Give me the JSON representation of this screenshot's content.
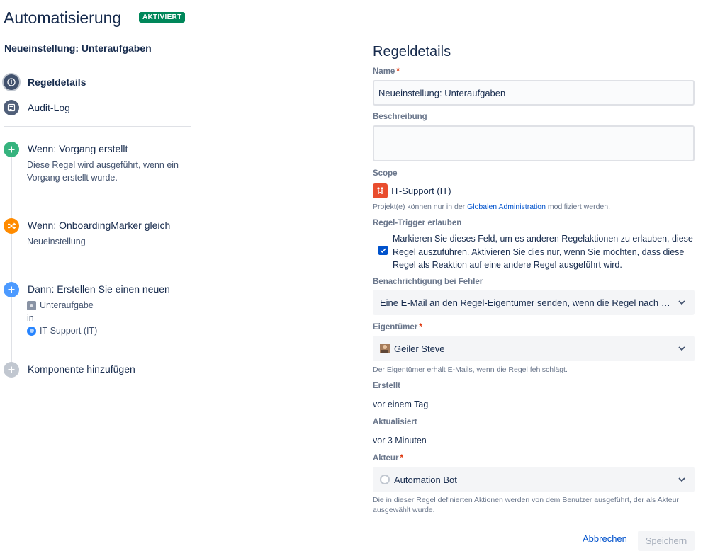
{
  "header": {
    "title": "Automatisierung",
    "status": "AKTIVIERT",
    "rule_name": "Neueinstellung: Unteraufgaben"
  },
  "nav": {
    "items": [
      {
        "label": "Regeldetails",
        "icon": "info-icon",
        "active": true
      },
      {
        "label": "Audit-Log",
        "icon": "list-icon",
        "active": false
      }
    ]
  },
  "components": [
    {
      "title": "Wenn: Vorgang erstellt",
      "icon": "plus-icon",
      "color": "#36b37e",
      "description": "Diese Regel wird ausgeführt, wenn ein Vorgang erstellt wurde."
    },
    {
      "title": "Wenn: OnboardingMarker gleich",
      "icon": "shuffle-icon",
      "color": "#ff8b00",
      "description": "Neueinstellung"
    },
    {
      "title": "Dann: Erstellen Sie einen neuen",
      "icon": "plus-icon",
      "color": "#4c9aff",
      "issue_type": "Unteraufgabe",
      "in": "in",
      "project": "IT-Support (IT)"
    },
    {
      "title": "Komponente hinzufügen",
      "icon": "plus-icon",
      "color": "#c1c7d0"
    }
  ],
  "form": {
    "title": "Regeldetails",
    "name_label": "Name",
    "name_value": "Neueinstellung: Unteraufgaben",
    "description_label": "Beschreibung",
    "scope_label": "Scope",
    "scope_value": "IT-Support (IT)",
    "scope_help_prefix": "Projekt(e) können nur in der ",
    "scope_help_link": "Globalen Administration",
    "scope_help_suffix": " modifiziert werden.",
    "trigger_label": "Regel-Trigger erlauben",
    "trigger_checked": true,
    "trigger_text": "Markieren Sie dieses Feld, um es anderen Regelaktionen zu erlauben, diese Regel auszuführen. Aktivieren Sie dies nur, wenn Sie möchten, dass diese Regel als Reaktion auf eine andere Regel ausgeführt wird.",
    "notify_label": "Benachrichtigung bei Fehler",
    "notify_value": "Eine E-Mail an den Regel-Eigentümer senden, wenn die Regel nach einer Ausführung fehlschlägt",
    "owner_label": "Eigentümer",
    "owner_value": "Geiler Steve",
    "owner_help": "Der Eigentümer erhält E-Mails, wenn die Regel fehlschlägt.",
    "created_label": "Erstellt",
    "created_value": "vor einem Tag",
    "updated_label": "Aktualisiert",
    "updated_value": "vor 3 Minuten",
    "actor_label": "Akteur",
    "actor_value": "Automation Bot",
    "actor_help": "Die in dieser Regel definierten Aktionen werden von dem Benutzer ausgeführt, der als Akteur ausgewählt wurde.",
    "required_mark": "*"
  },
  "actions": {
    "cancel": "Abbrechen",
    "save": "Speichern"
  }
}
